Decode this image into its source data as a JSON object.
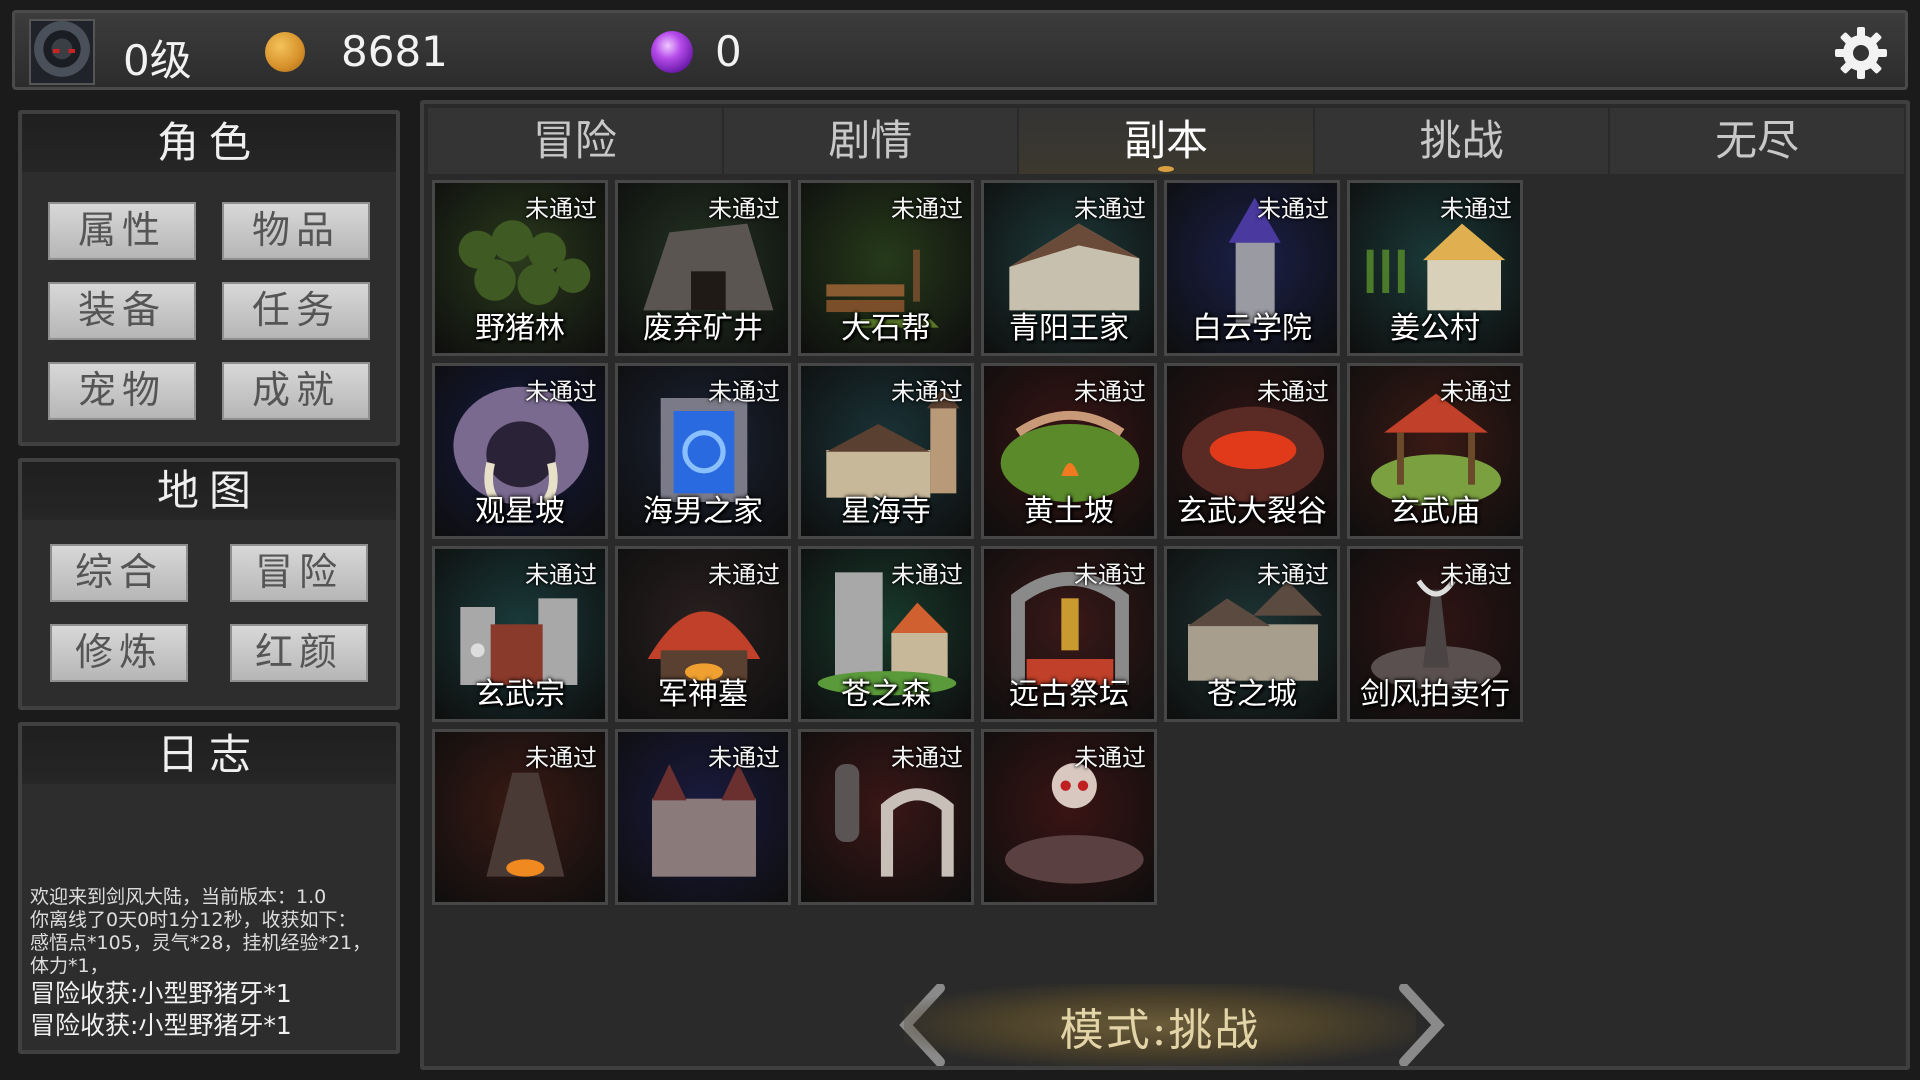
{
  "player": {
    "level": "0级",
    "gold": "8681",
    "gems": "0",
    "icons": [
      "hooded-avatar-icon",
      "gold-coin-icon",
      "purple-gem-icon",
      "gear-icon"
    ]
  },
  "sidebar": {
    "role": {
      "title": "角色",
      "buttons": [
        "属性",
        "物品",
        "装备",
        "任务",
        "宠物",
        "成就"
      ]
    },
    "map": {
      "title": "地图",
      "buttons": [
        "综合",
        "冒险",
        "修炼",
        "红颜"
      ]
    },
    "log": {
      "title": "日志",
      "lines": [
        "欢迎来到剑风大陆，当前版本：1.0",
        "你离线了0天0时1分12秒，收获如下：",
        "感悟点*105，灵气*28，挂机经验*21，",
        "体力*1，"
      ],
      "loot": [
        "冒险收获:小型野猪牙*1",
        "冒险收获:小型野猪牙*1"
      ]
    }
  },
  "tabs": [
    "冒险",
    "剧情",
    "副本",
    "挑战",
    "无尽"
  ],
  "active_tab": "副本",
  "dungeons": [
    {
      "name": "野猪林",
      "status": "未通过",
      "bg": "#2a3a1c",
      "icon": "forest-icon"
    },
    {
      "name": "废弃矿井",
      "status": "未通过",
      "bg": "#243322",
      "icon": "mine-icon"
    },
    {
      "name": "大石帮",
      "status": "未通过",
      "bg": "#263a1a",
      "icon": "logging-camp-icon"
    },
    {
      "name": "青阳王家",
      "status": "未通过",
      "bg": "#1e3a3a",
      "icon": "manor-icon"
    },
    {
      "name": "白云学院",
      "status": "未通过",
      "bg": "#1a2048",
      "icon": "tower-icon"
    },
    {
      "name": "姜公村",
      "status": "未通过",
      "bg": "#1a3a38",
      "icon": "farm-house-icon"
    },
    {
      "name": "观星坡",
      "status": "未通过",
      "bg": "#151a40",
      "icon": "tusk-cave-icon"
    },
    {
      "name": "海男之家",
      "status": "未通过",
      "bg": "#1b2234",
      "icon": "portal-icon"
    },
    {
      "name": "星海寺",
      "status": "未通过",
      "bg": "#1a3438",
      "icon": "temple-icon"
    },
    {
      "name": "黄土坡",
      "status": "未通过",
      "bg": "#3a1414",
      "icon": "campfire-icon"
    },
    {
      "name": "玄武大裂谷",
      "status": "未通过",
      "bg": "#301414",
      "icon": "lava-rift-icon"
    },
    {
      "name": "玄武庙",
      "status": "未通过",
      "bg": "#3a1a14",
      "icon": "pavilion-icon"
    },
    {
      "name": "玄武宗",
      "status": "未通过",
      "bg": "#1a3a3a",
      "icon": "fortress-icon"
    },
    {
      "name": "军神墓",
      "status": "未通过",
      "bg": "#2a2020",
      "icon": "tomb-tent-icon"
    },
    {
      "name": "苍之森",
      "status": "未通过",
      "bg": "#183a2c",
      "icon": "watchtower-icon"
    },
    {
      "name": "远古祭坛",
      "status": "未通过",
      "bg": "#3a1818",
      "icon": "altar-throne-icon"
    },
    {
      "name": "苍之城",
      "status": "未通过",
      "bg": "#1e3434",
      "icon": "castle-town-icon"
    },
    {
      "name": "剑风拍卖行",
      "status": "未通过",
      "bg": "#301414",
      "icon": "spire-icon"
    },
    {
      "name": "",
      "status": "未通过",
      "bg": "#3a1a14",
      "icon": "volcano-icon"
    },
    {
      "name": "",
      "status": "未通过",
      "bg": "#1a1a40",
      "icon": "purple-castle-icon"
    },
    {
      "name": "",
      "status": "未通过",
      "bg": "#3a1616",
      "icon": "statue-arch-icon"
    },
    {
      "name": "",
      "status": "未通过",
      "bg": "#3a1414",
      "icon": "skull-gate-icon"
    }
  ],
  "mode": {
    "label": "模式:挑战"
  }
}
